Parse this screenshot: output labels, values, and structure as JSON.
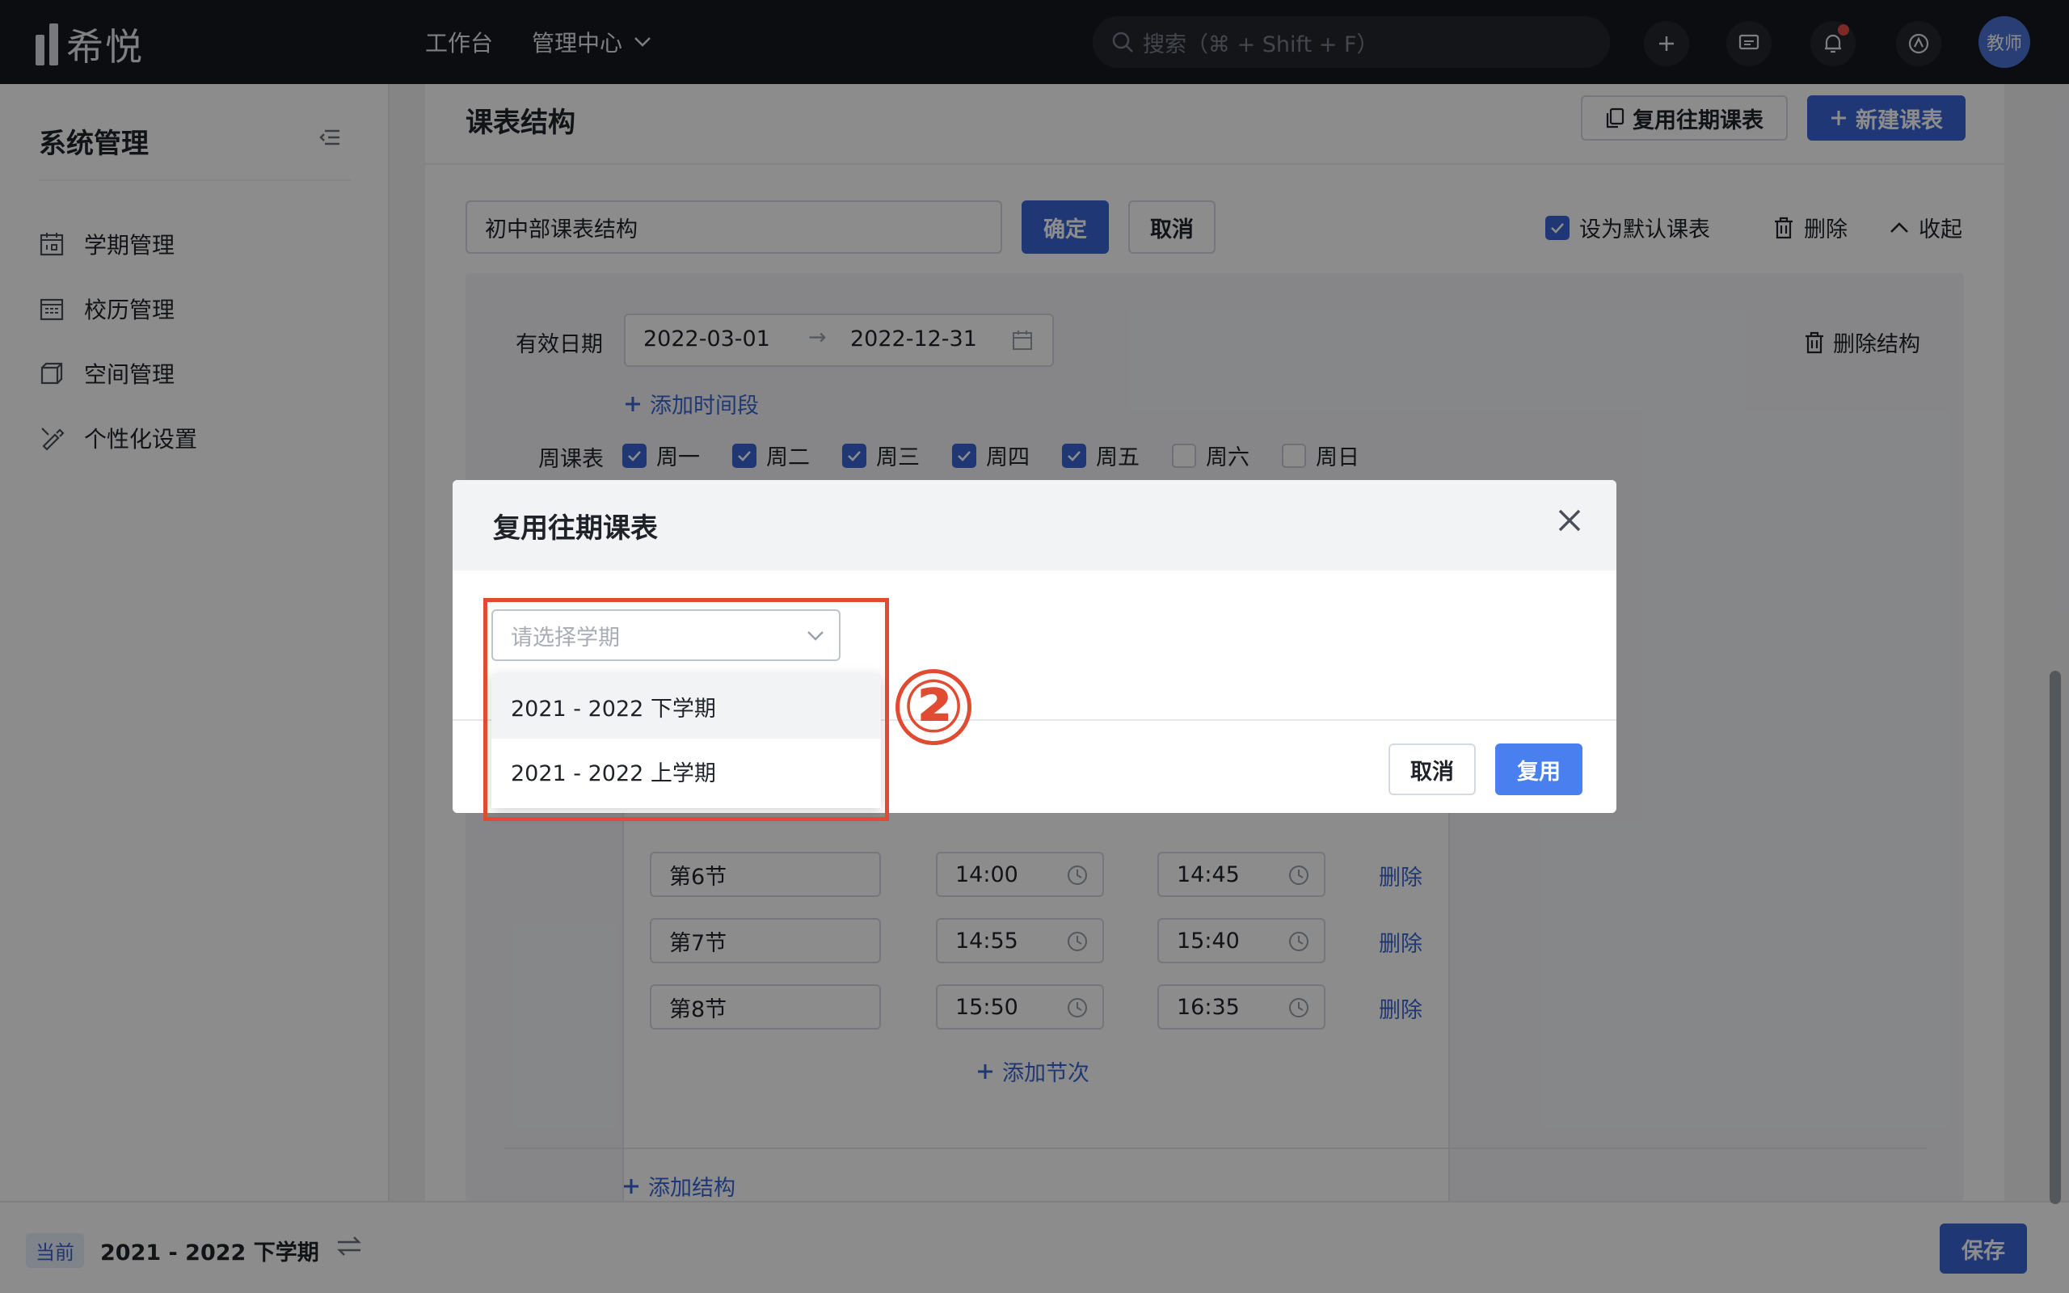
{
  "app": {
    "logo_text": "希悦",
    "nav": [
      "工作台",
      "管理中心"
    ],
    "search_placeholder": "搜索（⌘ + Shift + F）",
    "avatar_text": "教师"
  },
  "sidebar": {
    "title": "系统管理",
    "items": [
      {
        "label": "学期管理",
        "icon": "calendar-icon"
      },
      {
        "label": "校历管理",
        "icon": "schedule-icon"
      },
      {
        "label": "空间管理",
        "icon": "cube-icon"
      },
      {
        "label": "个性化设置",
        "icon": "brush-icon"
      }
    ],
    "current_badge": "当前",
    "current_term": "2021 - 2022 下学期"
  },
  "header": {
    "title": "课表结构",
    "reuse_button": "复用往期课表",
    "new_button": "新建课表"
  },
  "form": {
    "name_value": "初中部课表结构",
    "confirm": "确定",
    "cancel": "取消",
    "default_label": "设为默认课表",
    "delete": "删除",
    "collapse": "收起",
    "valid_date_label": "有效日期",
    "start_date": "2022-03-01",
    "end_date": "2022-12-31",
    "delete_structure": "删除结构",
    "add_period": "添加时间段",
    "week_label": "周课表",
    "days": [
      {
        "label": "周一",
        "checked": true
      },
      {
        "label": "周二",
        "checked": true
      },
      {
        "label": "周三",
        "checked": true
      },
      {
        "label": "周四",
        "checked": true
      },
      {
        "label": "周五",
        "checked": true
      },
      {
        "label": "周六",
        "checked": false
      },
      {
        "label": "周日",
        "checked": false
      }
    ],
    "lessons": [
      {
        "name": "第6节",
        "start": "14:00",
        "end": "14:45",
        "action": "删除"
      },
      {
        "name": "第7节",
        "start": "14:55",
        "end": "15:40",
        "action": "删除"
      },
      {
        "name": "第8节",
        "start": "15:50",
        "end": "16:35",
        "action": "删除"
      }
    ],
    "add_lesson": "添加节次",
    "add_structure": "添加结构",
    "save": "保存"
  },
  "modal": {
    "title": "复用往期课表",
    "select_placeholder": "请选择学期",
    "options": [
      "2021 - 2022 下学期",
      "2021 - 2022 上学期"
    ],
    "cancel": "取消",
    "confirm": "复用",
    "step_marker": "②"
  },
  "colors": {
    "primary": "#3a66d6",
    "highlight": "#e04b32",
    "topbar": "#16191f"
  }
}
